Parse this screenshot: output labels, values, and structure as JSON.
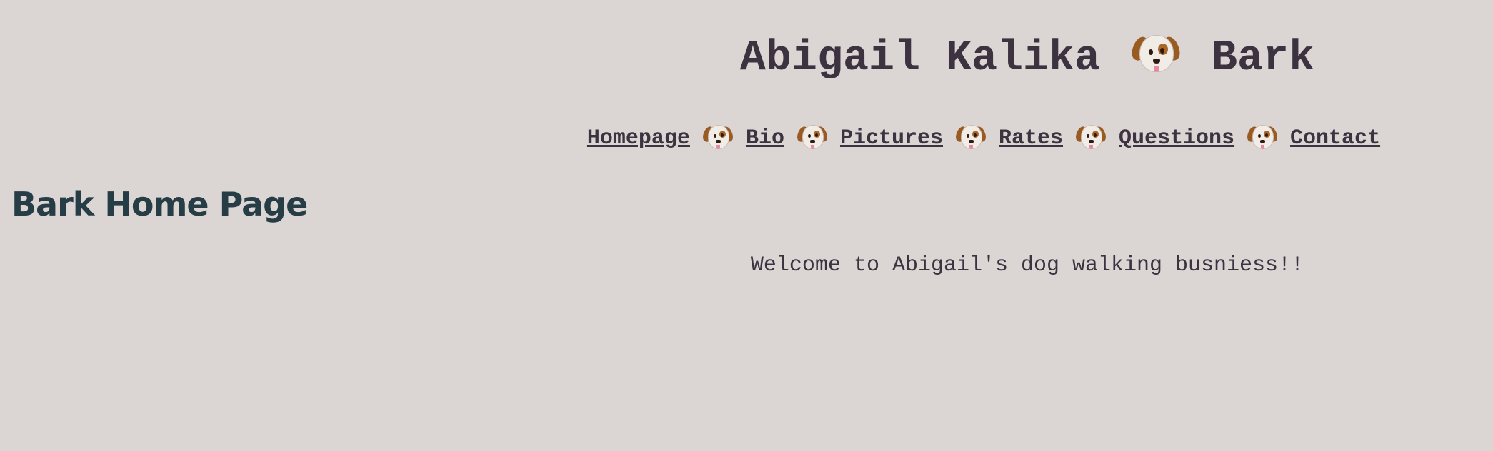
{
  "header": {
    "title_first": "Abigail Kalika",
    "title_second": "Bark",
    "title_icon": "dog-face-icon"
  },
  "nav": {
    "separator_icon": "dog-face-icon",
    "items": [
      {
        "label": "Homepage"
      },
      {
        "label": "Bio"
      },
      {
        "label": "Pictures"
      },
      {
        "label": "Rates"
      },
      {
        "label": "Questions"
      },
      {
        "label": "Contact"
      }
    ]
  },
  "main": {
    "page_heading": "Bark Home Page",
    "welcome_text": "Welcome to Abigail's dog walking busniess!!"
  },
  "colors": {
    "background": "#dbd6d4",
    "text": "#3d3340",
    "heading": "#273d45"
  }
}
